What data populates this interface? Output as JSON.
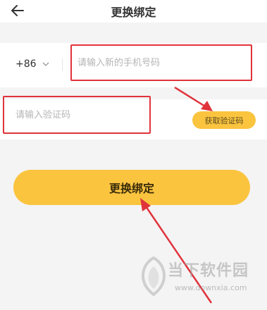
{
  "header": {
    "title": "更换绑定",
    "back_icon": "arrow-left-icon"
  },
  "phone_row": {
    "country_code": "+86",
    "chevron_icon": "chevron-down-icon",
    "placeholder": "请输入新的手机号码"
  },
  "code_row": {
    "placeholder": "请输入验证码",
    "get_code_label": "获取验证码"
  },
  "primary_button": {
    "label": "更换绑定"
  },
  "watermark": {
    "text": "当下软件园",
    "url": "www.downxia.com"
  },
  "colors": {
    "accent": "#fbc43f",
    "annotation_red": "#e0333b",
    "background": "#f4f4f4"
  }
}
